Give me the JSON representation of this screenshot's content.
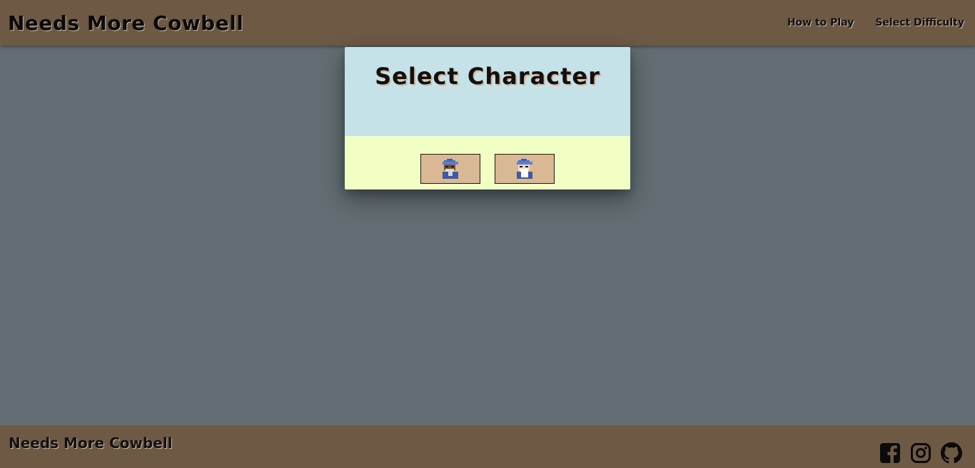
{
  "navbar": {
    "brand": "Needs More Cowbell",
    "links": [
      "How to Play",
      "Select Difficulty"
    ]
  },
  "modal": {
    "title": "Select Character",
    "characters": [
      {
        "icon": "wizard-dark-icon"
      },
      {
        "icon": "wizard-light-icon"
      }
    ]
  },
  "footer": {
    "brand": "Needs More Cowbell",
    "social": [
      "facebook-icon",
      "instagram-icon",
      "github-icon"
    ]
  },
  "colors": {
    "nav_bg": "#6e5945",
    "page_bg": "#626e73",
    "modal_top": "#c6e2e9",
    "modal_bottom": "#f1ffc4",
    "button_bg": "#dab894"
  }
}
